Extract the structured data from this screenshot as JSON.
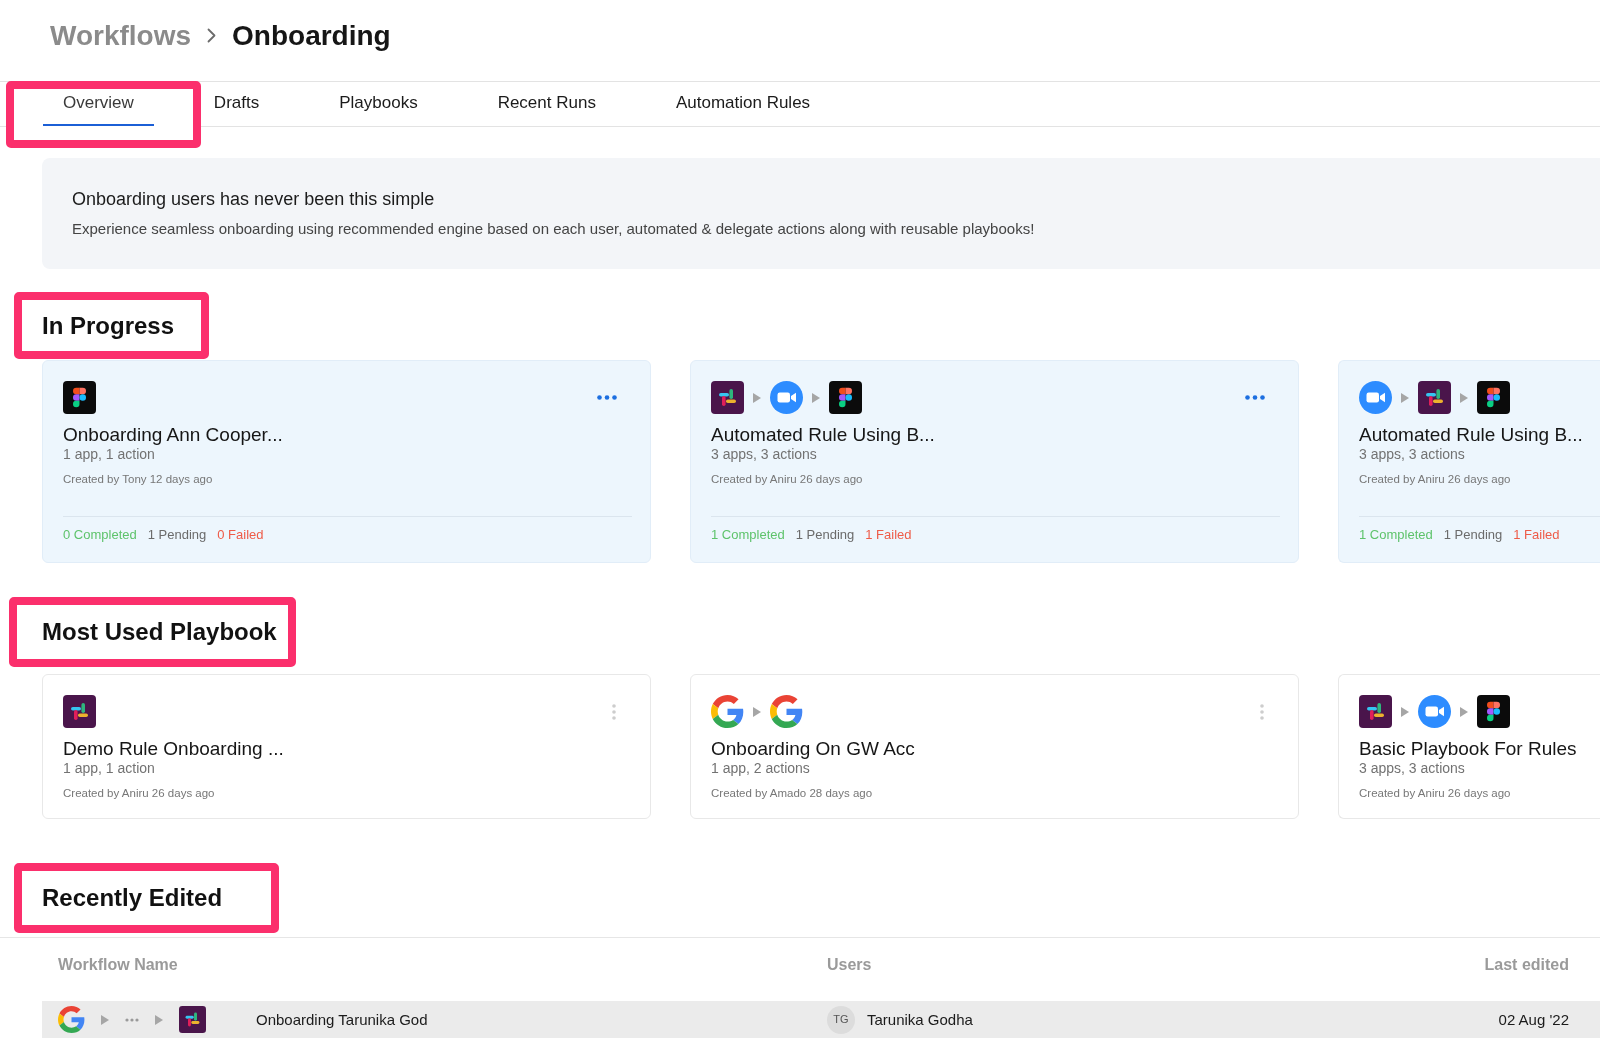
{
  "breadcrumb": [
    {
      "label": "Workflows",
      "current": false
    },
    {
      "label": "Onboarding",
      "current": true
    }
  ],
  "tabs": [
    {
      "label": "Overview",
      "selected": true,
      "highlighted": true
    },
    {
      "label": "Drafts",
      "selected": false,
      "highlighted": false
    },
    {
      "label": "Playbooks",
      "selected": false,
      "highlighted": false
    },
    {
      "label": "Recent Runs",
      "selected": false,
      "highlighted": false
    },
    {
      "label": "Automation Rules",
      "selected": false,
      "highlighted": false
    }
  ],
  "banner": {
    "title": "Onboarding users has never been this simple",
    "text": "Experience seamless onboarding using recommended engine based on each user, automated & delegate actions along with reusable playbooks!"
  },
  "sections": [
    {
      "kind": "runs",
      "heading": "In Progress",
      "highlighted": true,
      "cards": [
        {
          "title": "Onboarding Ann Cooper...",
          "summary": "1 app, 1 action",
          "created": "Created by Tony 12 days ago",
          "stats": [
            {
              "label": "0 Completed",
              "color": "#5ec36b"
            },
            {
              "label": "1 Pending",
              "color": "#6b6b6b"
            },
            {
              "label": "0 Failed",
              "color": "#ee5b48"
            }
          ]
        },
        {
          "title": "Automated Rule Using B...",
          "summary": "3 apps, 3 actions",
          "created": "Created by Aniru 26 days ago",
          "stats": [
            {
              "label": "1 Completed",
              "color": "#5ec36b"
            },
            {
              "label": "1 Pending",
              "color": "#6b6b6b"
            },
            {
              "label": "1 Failed",
              "color": "#ee5b48"
            }
          ]
        },
        {
          "title": "Automated Rule Using B...",
          "summary": "3 apps, 3 actions",
          "created": "Created by Aniru 26 days ago",
          "stats": [
            {
              "label": "1 Completed",
              "color": "#5ec36b"
            },
            {
              "label": "1 Pending",
              "color": "#6b6b6b"
            },
            {
              "label": "1 Failed",
              "color": "#ee5b48"
            }
          ]
        }
      ]
    },
    {
      "kind": "playbooks",
      "heading": "Most Used Playbook",
      "highlighted": true,
      "cards": [
        {
          "title": "Demo Rule Onboarding ...",
          "summary": "1 app, 1 action",
          "created": "Created by Aniru 26 days ago"
        },
        {
          "title": "Onboarding On GW Acc",
          "summary": "1 app, 2 actions",
          "created": "Created by Amado 28 days ago"
        },
        {
          "title": "Basic Playbook For Rules",
          "summary": "3 apps, 3 actions",
          "created": "Created by Aniru 26 days ago"
        }
      ]
    },
    {
      "kind": "table",
      "heading": "Recently Edited",
      "highlighted": true,
      "columns": [
        "Workflow Name",
        "Users",
        "Last edited"
      ],
      "rows": [
        {
          "selected": true,
          "workflow": "Onboarding Tarunika God",
          "initials": "TG",
          "user": "Tarunika Godha",
          "last_edited": "02 Aug '22"
        }
      ]
    }
  ]
}
